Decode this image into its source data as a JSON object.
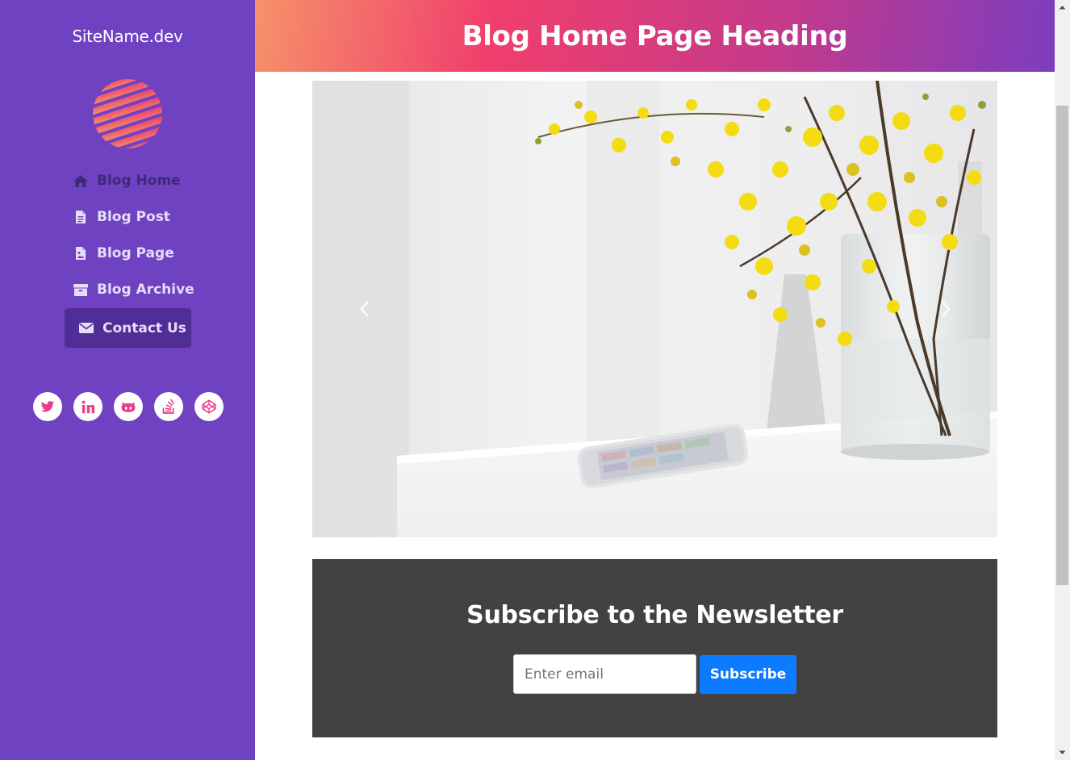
{
  "sidebar": {
    "site_name": "SiteName.dev",
    "logo_icon": "striped-globe-logo",
    "items": [
      {
        "label": "Blog Home",
        "icon": "home-icon",
        "state": "active"
      },
      {
        "label": "Blog Post",
        "icon": "file-text-icon",
        "state": "normal"
      },
      {
        "label": "Blog Page",
        "icon": "file-image-icon",
        "state": "normal"
      },
      {
        "label": "Blog Archive",
        "icon": "archive-icon",
        "state": "normal"
      },
      {
        "label": "Contact Us",
        "icon": "envelope-icon",
        "state": "highlighted"
      }
    ],
    "socials": [
      "twitter-icon",
      "linkedin-icon",
      "github-icon",
      "stack-overflow-icon",
      "codepen-icon"
    ]
  },
  "header": {
    "title": "Blog Home Page Heading"
  },
  "carousel": {
    "image": "flowers-vase-phone-photo",
    "prev_icon": "chevron-left-icon",
    "next_icon": "chevron-right-icon"
  },
  "newsletter": {
    "title": "Subscribe to the Newsletter",
    "email_placeholder": "Enter email",
    "email_value": "",
    "button_label": "Subscribe"
  },
  "colors": {
    "sidebar_bg": "#6f42c1",
    "accent_pink": "#e83e8c",
    "newsletter_bg": "#424242",
    "button_blue": "#0d7bff"
  }
}
